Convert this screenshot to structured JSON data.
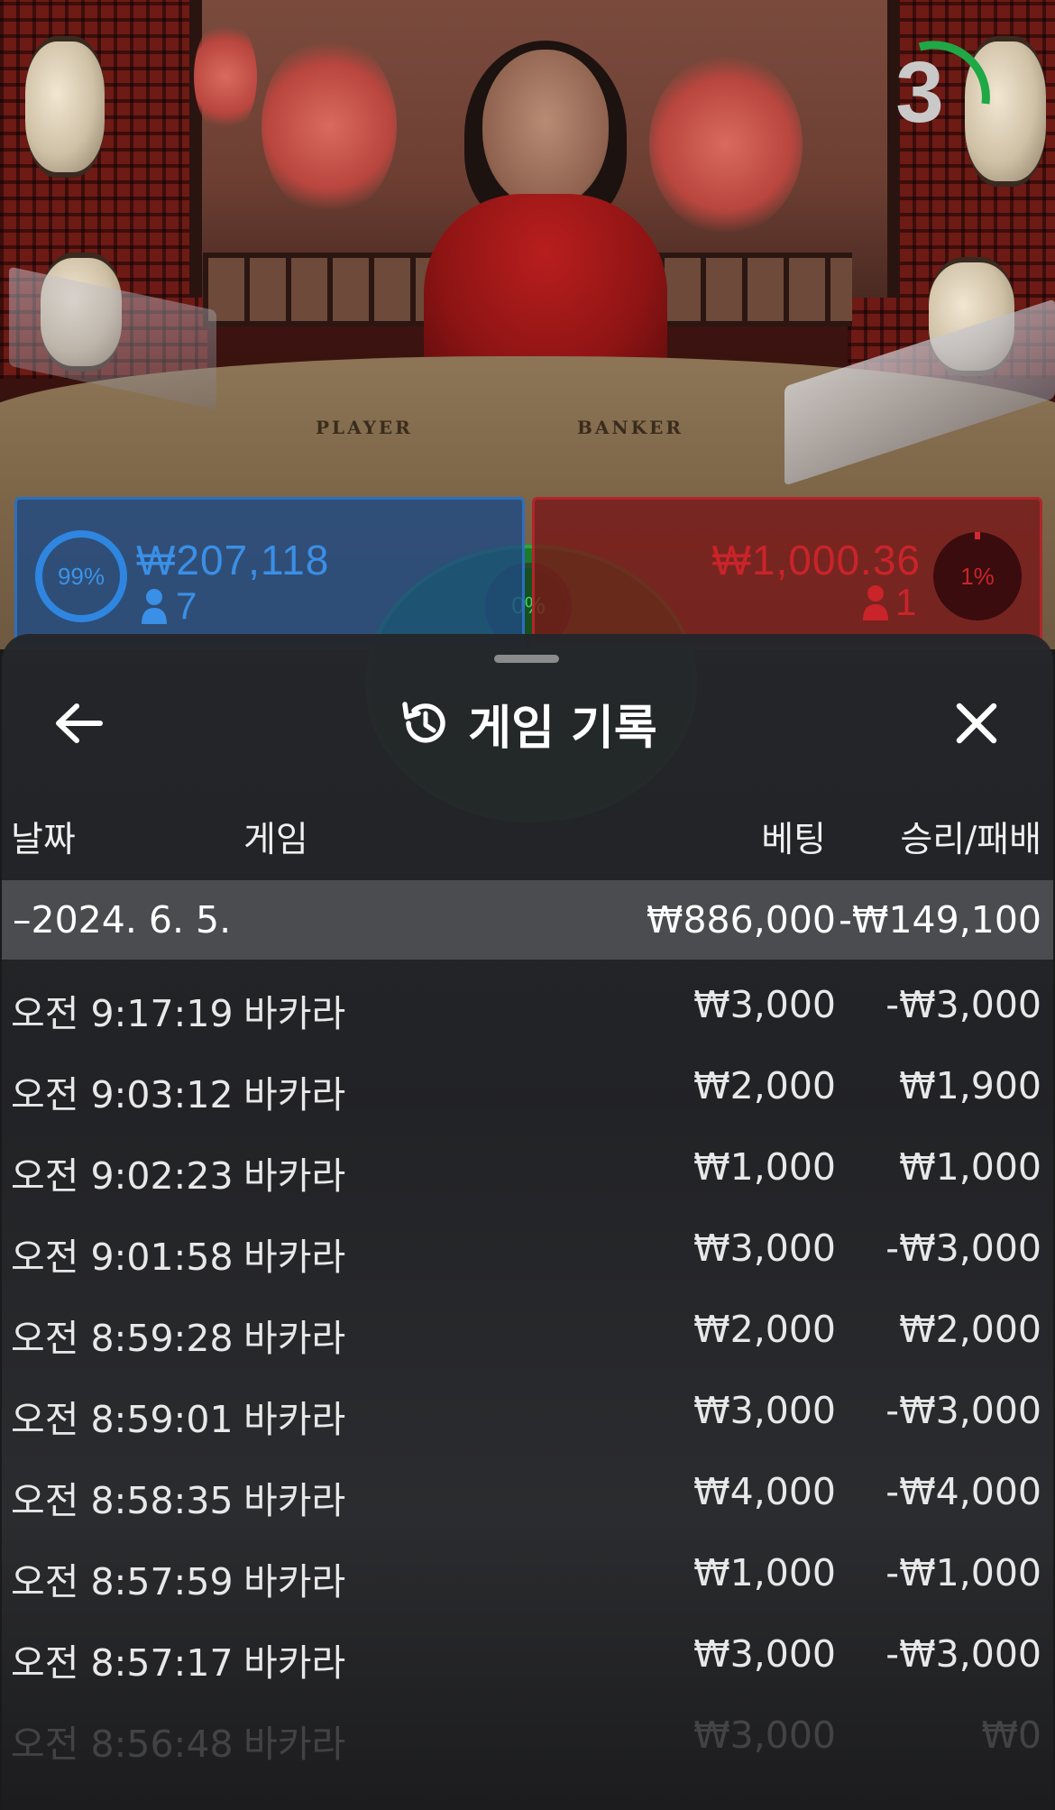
{
  "scene": {
    "table_labels": {
      "player": "PLAYER",
      "banker": "BANKER"
    },
    "timer": {
      "value": "3",
      "accent": "#1fa846"
    }
  },
  "bets": {
    "player": {
      "percent": "99%",
      "amount": "₩207,118",
      "players": "7",
      "color": "#2b6fc0"
    },
    "tie": {
      "percent": "0%",
      "color": "#27a838"
    },
    "banker": {
      "percent": "1%",
      "amount": "₩1,000.36",
      "players": "1",
      "color": "#b0262a"
    }
  },
  "history": {
    "title": "게임 기록",
    "icons": {
      "back": "arrow-left-icon",
      "title": "history-clock-icon",
      "close": "close-icon"
    },
    "columns": {
      "date": "날짜",
      "game": "게임",
      "bet": "베팅",
      "result": "승리/패배"
    },
    "date_group": {
      "label": "–2024. 6. 5.",
      "total_bet": "₩886,000",
      "total_result": "-₩149,100"
    },
    "rows": [
      {
        "time": "오전 9:17:19",
        "game": "바카라",
        "bet": "₩3,000",
        "result": "-₩3,000"
      },
      {
        "time": "오전 9:03:12",
        "game": "바카라",
        "bet": "₩2,000",
        "result": "₩1,900"
      },
      {
        "time": "오전 9:02:23",
        "game": "바카라",
        "bet": "₩1,000",
        "result": "₩1,000"
      },
      {
        "time": "오전 9:01:58",
        "game": "바카라",
        "bet": "₩3,000",
        "result": "-₩3,000"
      },
      {
        "time": "오전 8:59:28",
        "game": "바카라",
        "bet": "₩2,000",
        "result": "₩2,000"
      },
      {
        "time": "오전 8:59:01",
        "game": "바카라",
        "bet": "₩3,000",
        "result": "-₩3,000"
      },
      {
        "time": "오전 8:58:35",
        "game": "바카라",
        "bet": "₩4,000",
        "result": "-₩4,000"
      },
      {
        "time": "오전 8:57:59",
        "game": "바카라",
        "bet": "₩1,000",
        "result": "-₩1,000"
      },
      {
        "time": "오전 8:57:17",
        "game": "바카라",
        "bet": "₩3,000",
        "result": "-₩3,000"
      },
      {
        "time": "오전 8:56:48",
        "game": "바카라",
        "bet": "₩3,000",
        "result": "₩0"
      }
    ]
  }
}
